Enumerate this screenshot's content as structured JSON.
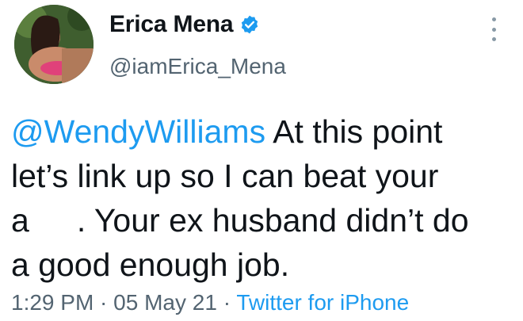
{
  "profile": {
    "display_name": "Erica Mena",
    "handle": "@iamErica_Mena",
    "verified": true,
    "avatar_icon": "profile-photo",
    "verified_icon": "verified-badge-icon",
    "more_icon": "more-options-icon"
  },
  "tweet": {
    "mention": "@WendyWilliams",
    "line1_rest": " At this point",
    "line2": "let’s link up so I can beat your",
    "line3_start": "a",
    "line3_rest": ". Your ex husband didn’t do",
    "line4": "a good enough job."
  },
  "meta": {
    "time": "1:29 PM",
    "sep1": " · ",
    "date": "05 May 21",
    "sep2": " · ",
    "source": "Twitter for iPhone"
  },
  "colors": {
    "link": "#1d9bf0",
    "secondary_text": "#536471",
    "primary_text": "#0f1419",
    "background": "#ffffff"
  }
}
